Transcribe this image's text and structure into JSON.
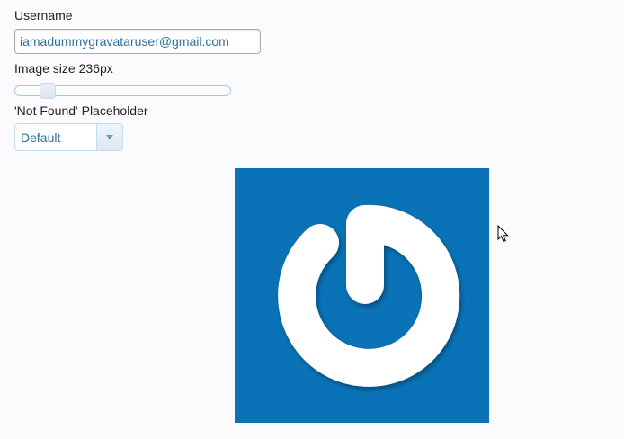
{
  "form": {
    "username_label": "Username",
    "username_value": "iamadummygravataruser@gmail.com",
    "size_label": "Image size 236px",
    "size_slider_fraction": 0.12,
    "placeholder_label": "'Not Found' Placeholder",
    "placeholder_selected": "Default"
  },
  "avatar": {
    "icon": "gravatar-logo-icon",
    "background_color": "#0a73b7",
    "logo_color": "#ffffff"
  },
  "colors": {
    "input_text": "#2e6e9e",
    "widget_border": "#c5dbec",
    "slider_border": "#a6c9e2"
  }
}
